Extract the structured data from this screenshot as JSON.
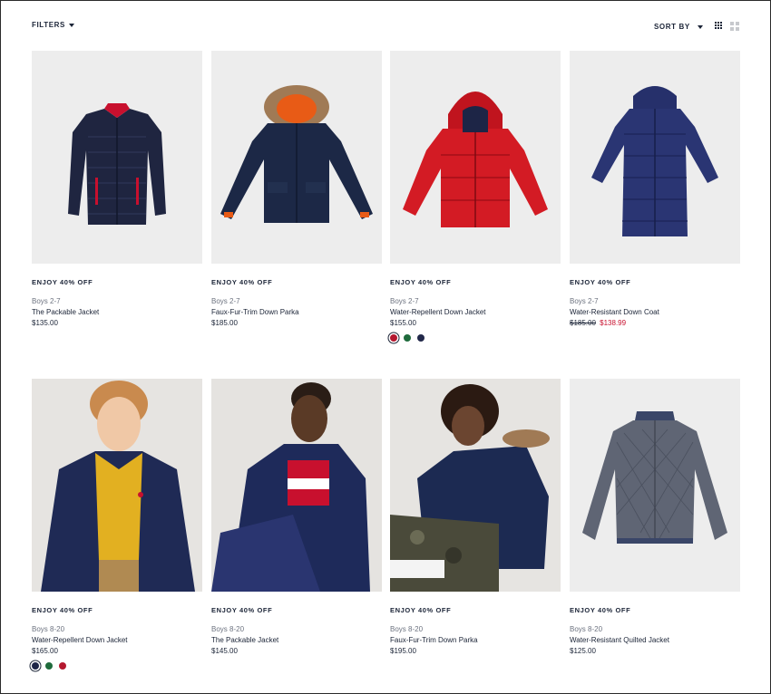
{
  "toolbar": {
    "filters_label": "FILTERS",
    "sort_label": "SORT BY"
  },
  "products": [
    {
      "promo": "ENJOY 40% OFF",
      "category": "Boys 2-7",
      "name": "The Packable Jacket",
      "price": "$135.00"
    },
    {
      "promo": "ENJOY 40% OFF",
      "category": "Boys 2-7",
      "name": "Faux-Fur-Trim Down Parka",
      "price": "$185.00"
    },
    {
      "promo": "ENJOY 40% OFF",
      "category": "Boys 2-7",
      "name": "Water-Repellent Down Jacket",
      "price": "$155.00",
      "swatches": [
        "#b4182f",
        "#1f6b3c",
        "#22284a"
      ]
    },
    {
      "promo": "ENJOY 40% OFF",
      "category": "Boys 2-7",
      "name": "Water-Resistant Down Coat",
      "price_original": "$185.00",
      "price_sale": "$138.99"
    },
    {
      "promo": "ENJOY 40% OFF",
      "category": "Boys 8-20",
      "name": "Water-Repellent Down Jacket",
      "price": "$165.00",
      "swatches": [
        "#1d2547",
        "#1f6b3c",
        "#b4182f"
      ]
    },
    {
      "promo": "ENJOY 40% OFF",
      "category": "Boys 8-20",
      "name": "The Packable Jacket",
      "price": "$145.00"
    },
    {
      "promo": "ENJOY 40% OFF",
      "category": "Boys 8-20",
      "name": "Faux-Fur-Trim Down Parka",
      "price": "$195.00"
    },
    {
      "promo": "ENJOY 40% OFF",
      "category": "Boys 8-20",
      "name": "Water-Resistant Quilted Jacket",
      "price": "$125.00"
    }
  ],
  "colors": {
    "navy": "#1b2437",
    "sale_red": "#c8102e",
    "image_bg": "#ededed"
  }
}
